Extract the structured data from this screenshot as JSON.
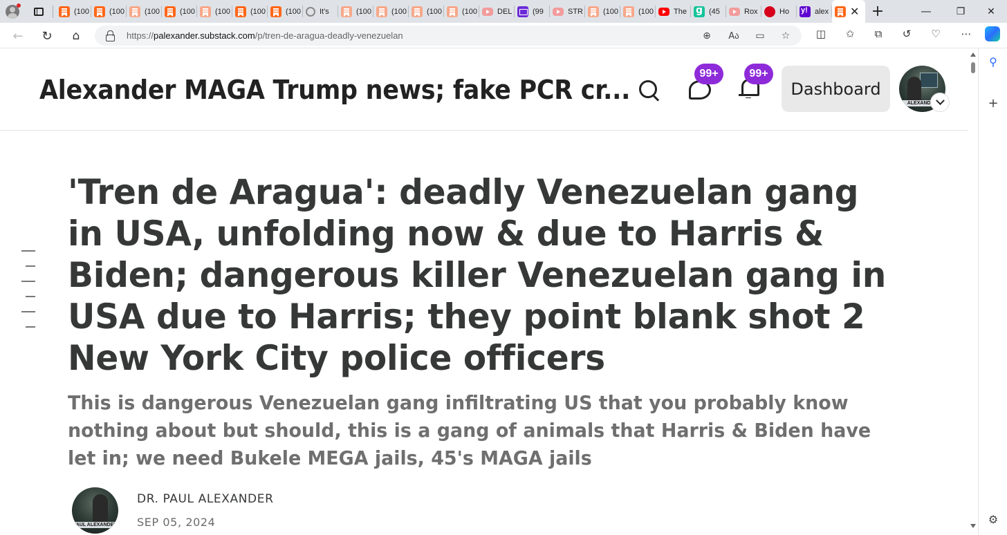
{
  "browser": {
    "tabs": [
      {
        "label": "(100",
        "icon": "substack-icon"
      },
      {
        "label": "(100",
        "icon": "substack-icon"
      },
      {
        "label": "(100",
        "icon": "substack-icon"
      },
      {
        "label": "(100",
        "icon": "substack-icon"
      },
      {
        "label": "(100",
        "icon": "substack-icon"
      },
      {
        "label": "(100",
        "icon": "substack-icon"
      },
      {
        "label": "(100",
        "icon": "substack-icon"
      },
      {
        "label": "It's",
        "icon": "page-icon"
      },
      {
        "label": "(100",
        "icon": "substack-icon"
      },
      {
        "label": "(100",
        "icon": "substack-icon"
      },
      {
        "label": "(100",
        "icon": "substack-icon"
      },
      {
        "label": "(100",
        "icon": "substack-icon"
      },
      {
        "label": "DEL",
        "icon": "youtube-icon"
      },
      {
        "label": "(99",
        "icon": "mail-icon"
      },
      {
        "label": "STR",
        "icon": "youtube-icon"
      },
      {
        "label": "(100",
        "icon": "substack-icon"
      },
      {
        "label": "(100",
        "icon": "substack-icon"
      },
      {
        "label": "The",
        "icon": "youtube-icon"
      },
      {
        "label": "(45",
        "icon": "grammarly-icon"
      },
      {
        "label": "Rox",
        "icon": "youtube-icon"
      },
      {
        "label": "Ho",
        "icon": "red-circle-icon"
      },
      {
        "label": "alex",
        "icon": "yahoo-icon"
      }
    ],
    "active_tab_close": "✕",
    "new_tab": "+",
    "url_prefix": "https://",
    "url_host": "palexander.substack.com",
    "url_path": "/p/tren-de-aragua-deadly-venezuelan",
    "colors": {
      "substack": "#ff6719",
      "badge": "#8e2bd9"
    }
  },
  "header": {
    "publication_title": "Alexander MAGA Trump news; fake PCR cr...",
    "chat_badge": "99+",
    "notifications_badge": "99+",
    "dashboard_label": "Dashboard",
    "avatar_banner": "ALEXANDER"
  },
  "article": {
    "title": "'Tren de Aragua': deadly Venezuelan gang in USA, unfolding now & due to Harris & Biden; dangerous killer Venezuelan gang in USA due to Harris; they point blank shot 2 New York City police officers",
    "subtitle": "This is dangerous Venezuelan gang infiltrating US that you probably know nothing about but should, this is a gang of animals that Harris & Biden have let in; we need Bukele MEGA jails, 45's MAGA jails",
    "author": "DR. PAUL ALEXANDER",
    "date": "SEP 05, 2024",
    "byline_avatar_banner": "PAUL ALEXANDER"
  }
}
